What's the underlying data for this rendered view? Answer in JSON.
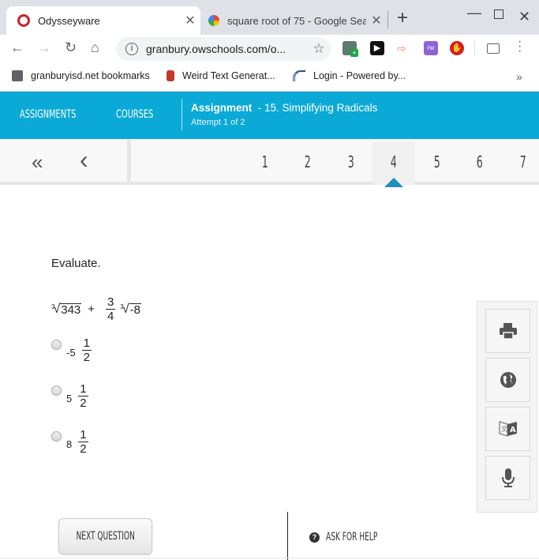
{
  "browser": {
    "tabs": [
      {
        "title": "Odysseyware",
        "active": true,
        "favicon": "odysseyware-icon"
      },
      {
        "title": "square root of 75 - Google Sear",
        "active": false,
        "favicon": "google-icon"
      }
    ],
    "new_tab": "+",
    "window": {
      "minimize": "—",
      "maximize": "☐",
      "close": "✕"
    },
    "url": "granbury.owschools.com/o...",
    "bookmarks": [
      {
        "label": "granburyisd.net bookmarks",
        "icon": "folder-icon"
      },
      {
        "label": "Weird Text Generat...",
        "icon": "jar-icon"
      },
      {
        "label": "Login - Powered by...",
        "icon": "skyward-icon"
      }
    ],
    "bookmarks_more": "»"
  },
  "header": {
    "nav": [
      "ASSIGNMENTS",
      "COURSES"
    ],
    "assignment_label": "Assignment",
    "assignment_title": "- 15. Simplifying Radicals",
    "attempt": "Attempt 1 of 2",
    "color": "#0ba9d6"
  },
  "question_nav": {
    "first": "«",
    "prev": "‹",
    "numbers": [
      "1",
      "2",
      "3",
      "4",
      "5",
      "6",
      "7"
    ],
    "current": "4"
  },
  "question": {
    "prompt": "Evaluate.",
    "expression": {
      "term1": {
        "index": "3",
        "radicand": "343"
      },
      "operator": "+",
      "coefficient": {
        "numerator": "3",
        "denominator": "4"
      },
      "term2": {
        "index": "3",
        "radicand": "-8"
      }
    },
    "options": [
      {
        "whole": "-5",
        "numerator": "1",
        "denominator": "2",
        "selected": false
      },
      {
        "whole": "5",
        "numerator": "1",
        "denominator": "2",
        "selected": false
      },
      {
        "whole": "8",
        "numerator": "1",
        "denominator": "2",
        "selected": false
      }
    ]
  },
  "tools": [
    "print-icon",
    "globe-icon",
    "translate-icon",
    "microphone-icon"
  ],
  "footer": {
    "next": "NEXT QUESTION",
    "help": "ASK FOR HELP"
  }
}
